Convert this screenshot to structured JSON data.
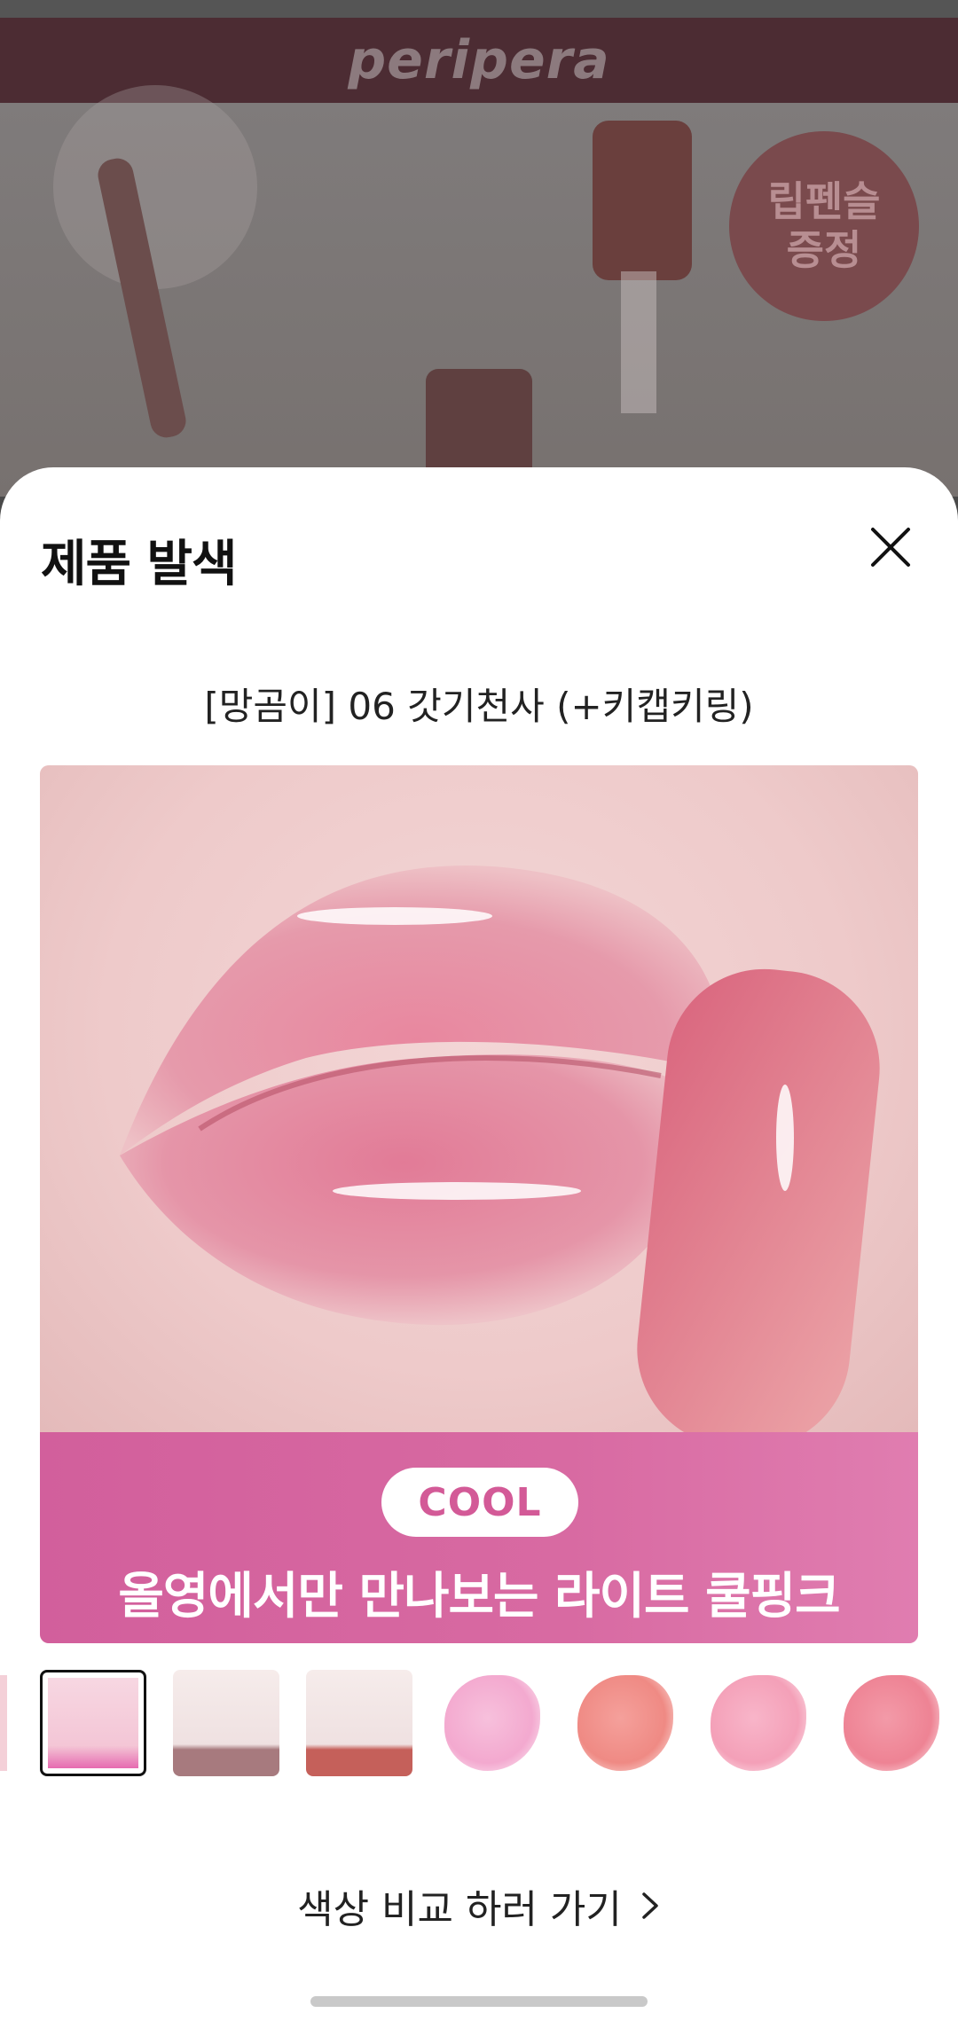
{
  "background": {
    "brand_logo": "peripera",
    "badge_text": "립펜슬\n증정"
  },
  "sheet": {
    "title": "제품 발색",
    "close_icon": "close-icon",
    "product_name": "[망곰이] 06 갓기천사 (+키캡키링)",
    "image_badge": "COOL",
    "image_caption": "올영에서만 만나보는 라이트 쿨핑크",
    "thumbnails": [
      {
        "name": "thumb-partial",
        "color": "#e5a3b0"
      },
      {
        "name": "thumb-set",
        "color": "#f4c6d6",
        "selected": true
      },
      {
        "name": "thumb-pencil-mauve",
        "color": "#b5868a"
      },
      {
        "name": "thumb-pencil-coral",
        "color": "#c5605a"
      },
      {
        "name": "thumb-swatch-lightpink",
        "color": "#f3a9cf"
      },
      {
        "name": "thumb-swatch-coral",
        "color": "#ef8a84"
      },
      {
        "name": "thumb-swatch-pink",
        "color": "#f4a0b8"
      },
      {
        "name": "thumb-swatch-rose",
        "color": "#ee8394"
      }
    ],
    "compare_link": "색상 비교 하러 가기",
    "compare_icon": "chevron-right-icon"
  }
}
